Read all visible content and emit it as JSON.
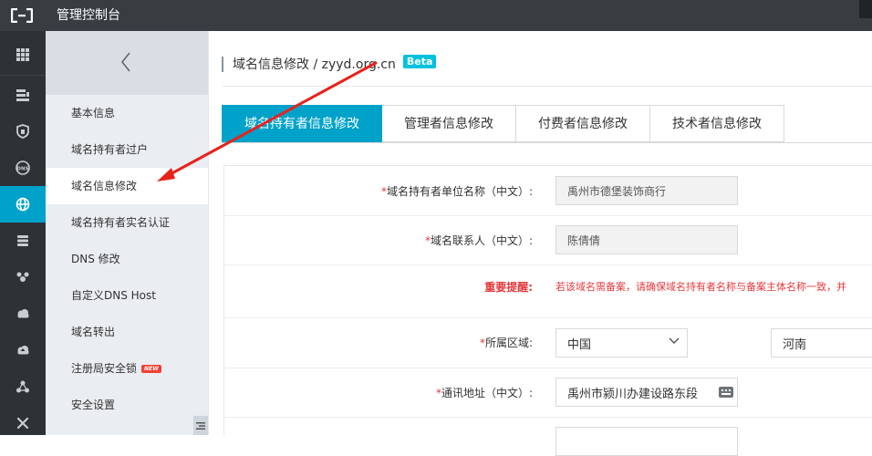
{
  "header": {
    "title": "管理控制台"
  },
  "rail": {
    "items": [
      {
        "icon": "grid-icon"
      },
      {
        "icon": "server-stack-icon"
      },
      {
        "icon": "shield-icon"
      },
      {
        "icon": "dns-icon",
        "label": "DNS"
      },
      {
        "icon": "globe-icon",
        "active": true
      },
      {
        "icon": "database-icon"
      },
      {
        "icon": "group-icon"
      },
      {
        "icon": "cloud-icon"
      },
      {
        "icon": "cloud-upload-icon"
      },
      {
        "icon": "nodes-icon"
      },
      {
        "icon": "tools-icon"
      }
    ]
  },
  "subnav": {
    "collapse_icon": "chevron-left-icon",
    "items": [
      {
        "label": "基本信息"
      },
      {
        "label": "域名持有者过户"
      },
      {
        "label": "域名信息修改",
        "active": true
      },
      {
        "label": "域名持有者实名认证"
      },
      {
        "label": "DNS 修改"
      },
      {
        "label": "自定义DNS Host"
      },
      {
        "label": "域名转出"
      },
      {
        "label": "注册局安全锁",
        "badge": "NEW"
      },
      {
        "label": "安全设置"
      }
    ]
  },
  "main": {
    "title": "域名信息修改 / zyyd.org.cn",
    "badge": "Beta",
    "tabs": [
      {
        "label": "域名持有者信息修改",
        "active": true
      },
      {
        "label": "管理者信息修改"
      },
      {
        "label": "付费者信息修改"
      },
      {
        "label": "技术者信息修改"
      }
    ],
    "form": {
      "org_label_star": "*",
      "org_label": "域名持有者单位名称（中文）:",
      "org_value": "禹州市德堡装饰商行",
      "contact_label_star": "*",
      "contact_label": "域名联系人（中文）:",
      "contact_value": "陈倩倩",
      "warning_label": "重要提醒:",
      "warning_text": "若该域名需备案，请确保域名持有者名称与备案主体名称一致，并",
      "region_label_star": "*",
      "region_label": "所属区域:",
      "country_value": "中国",
      "province_value": "河南",
      "address_label_star": "*",
      "address_label": "通讯地址（中文）:",
      "address_value": "禹州市颍川办建设路东段"
    }
  },
  "colors": {
    "accent": "#00a2ca",
    "annotation": "#e8221b",
    "required": "#e4393c"
  }
}
